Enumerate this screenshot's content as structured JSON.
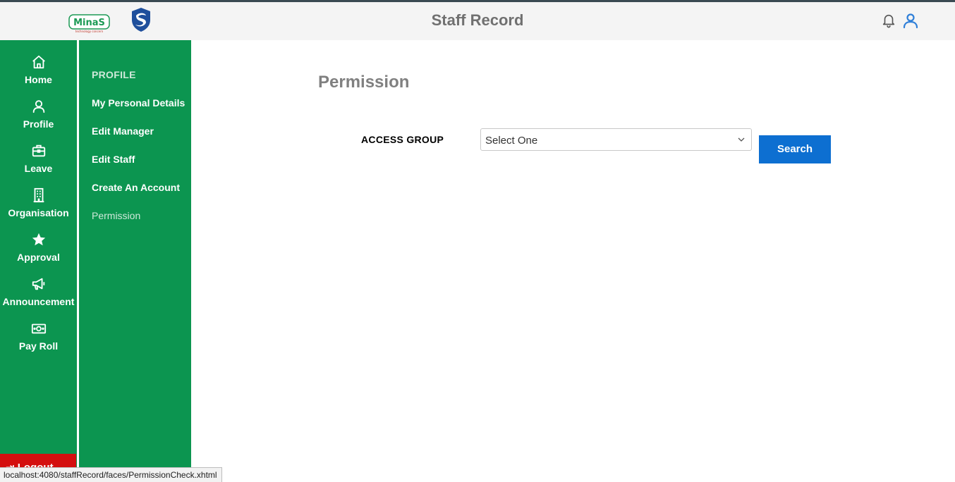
{
  "header": {
    "title": "Staff Record",
    "logo_text": "MinaS",
    "logo_subtext": "technology concern",
    "icons": [
      "bell-icon",
      "user-icon"
    ]
  },
  "rail": {
    "items": [
      {
        "label": "Home",
        "icon": "home-icon"
      },
      {
        "label": "Profile",
        "icon": "user-icon"
      },
      {
        "label": "Leave",
        "icon": "briefcase-icon"
      },
      {
        "label": "Organisation",
        "icon": "building-icon"
      },
      {
        "label": "Approval",
        "icon": "star-icon"
      },
      {
        "label": "Announcement",
        "icon": "megaphone-icon"
      },
      {
        "label": "Pay Roll",
        "icon": "money-icon"
      }
    ],
    "logout_label": "Logout"
  },
  "submenu": {
    "heading": "PROFILE",
    "items": [
      {
        "label": "My Personal Details"
      },
      {
        "label": "Edit Manager"
      },
      {
        "label": "Edit Staff"
      },
      {
        "label": "Create An Account"
      },
      {
        "label": "Permission",
        "active": true
      }
    ]
  },
  "main": {
    "title": "Permission",
    "access_group_label": "ACCESS GROUP",
    "access_group_value": "Select One",
    "search_label": "Search"
  },
  "status_bar": {
    "url": "localhost:4080/staffRecord/faces/PermissionCheck.xhtml"
  },
  "colors": {
    "sidebar_green": "#0c9550",
    "accent_blue": "#0d6fd1",
    "logout_red": "#d40f0f"
  }
}
